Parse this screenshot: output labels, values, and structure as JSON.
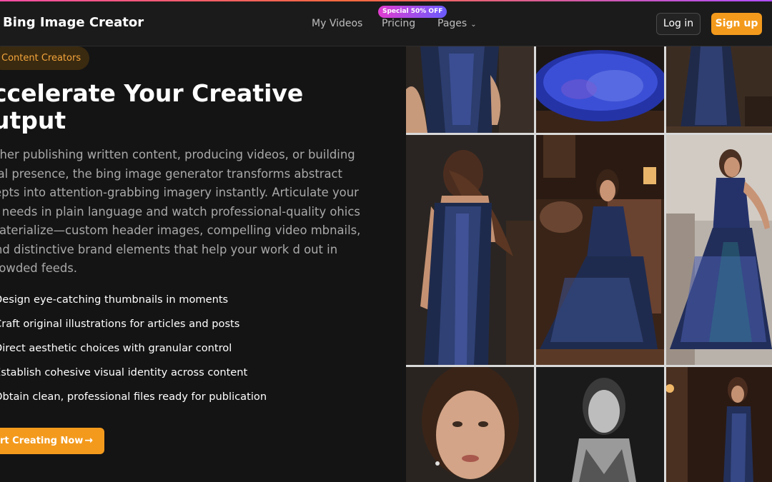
{
  "header": {
    "brand": "Bing Image Creator",
    "nav": {
      "my_videos": "My Videos",
      "pricing": "Pricing",
      "pages": "Pages",
      "promo_badge": "Special 50% OFF"
    },
    "login_label": "Log in",
    "signup_label": "Sign up"
  },
  "hero": {
    "pill_label": "Content Creators",
    "title_line1": "ccelerate Your Creative",
    "title_line2": "utput",
    "description": "ether publishing written content, producing videos, or building cial presence, the bing image generator transforms abstract cepts into attention-grabbing imagery instantly. Articulate your al needs in plain language and watch professional-quality ohics materialize—custom header images, compelling video mbnails, and distinctive brand elements that help your work d out in crowded feeds.",
    "features": [
      "Design eye-catching thumbnails in moments",
      "Craft original illustrations for articles and posts",
      "Direct aesthetic choices with granular control",
      "Establish cohesive visual identity across content",
      "Obtain clean, professional files ready for publication"
    ],
    "cta_label": "rt Creating Now",
    "cta_icon": "arrow-right-icon"
  },
  "colors": {
    "accent": "#f39a1d",
    "background": "#141414",
    "header_bg": "#1b1b1b",
    "dress": "#1e2a4a",
    "sequin_highlight": "#5a6fd8"
  },
  "gallery": {
    "images": [
      "sequin-gown-back-view",
      "sequin-gown-twirl-skirt",
      "sequin-gown-full-length",
      "woman-back-sequin-dress",
      "woman-seated-armchair-sequin-gown",
      "woman-dancing-sequin-gown",
      "woman-portrait-closeup",
      "woman-black-white-portrait",
      "woman-sequin-gown-dark-room"
    ]
  }
}
